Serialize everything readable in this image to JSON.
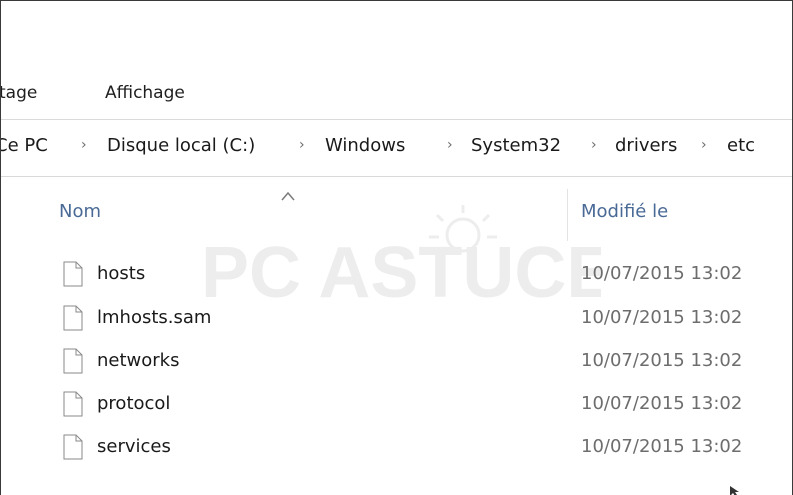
{
  "ribbon": {
    "tabs": [
      {
        "label": "tage"
      },
      {
        "label": "Affichage"
      }
    ]
  },
  "address": {
    "crumbs": [
      {
        "label": "Ce PC"
      },
      {
        "label": "Disque local (C:)"
      },
      {
        "label": "Windows"
      },
      {
        "label": "System32"
      },
      {
        "label": "drivers"
      },
      {
        "label": "etc"
      }
    ],
    "separator": "›"
  },
  "columns": {
    "name": "Nom",
    "modified": "Modifié le",
    "sort": "ascending"
  },
  "files": [
    {
      "name": "hosts",
      "modified": "10/07/2015 13:02",
      "icon": "file-icon"
    },
    {
      "name": "lmhosts.sam",
      "modified": "10/07/2015 13:02",
      "icon": "file-icon"
    },
    {
      "name": "networks",
      "modified": "10/07/2015 13:02",
      "icon": "file-icon"
    },
    {
      "name": "protocol",
      "modified": "10/07/2015 13:02",
      "icon": "file-icon"
    },
    {
      "name": "services",
      "modified": "10/07/2015 13:02",
      "icon": "file-icon"
    }
  ],
  "watermark": {
    "text": "PC ASTUCES"
  },
  "colors": {
    "header_text": "#4a6a96",
    "date_text": "#6d6d6d",
    "divider": "#dadada"
  }
}
